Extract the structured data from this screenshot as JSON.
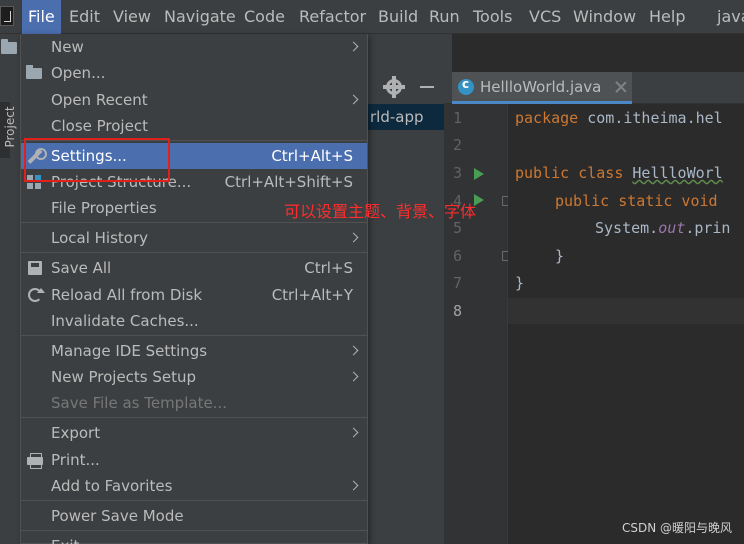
{
  "menubar": {
    "items": [
      {
        "label": "File",
        "active": true
      },
      {
        "label": "Edit"
      },
      {
        "label": "View"
      },
      {
        "label": "Navigate"
      },
      {
        "label": "Code"
      },
      {
        "label": "Refactor"
      },
      {
        "label": "Build"
      },
      {
        "label": "Run"
      },
      {
        "label": "Tools"
      },
      {
        "label": "VCS"
      },
      {
        "label": "Window"
      },
      {
        "label": "Help"
      }
    ],
    "title_fragment": "java"
  },
  "left_strip": {
    "tab_label": "Project"
  },
  "project_panel": {
    "row_label": "rld-app"
  },
  "editor": {
    "tab_label": "HellloWorld.java",
    "line_numbers": [
      "1",
      "2",
      "3",
      "4",
      "5",
      "6",
      "7",
      "8"
    ],
    "code": {
      "l1_kw": "package",
      "l1_rest": " com.itheima.hel",
      "l3_kw": "public class",
      "l3_rest": "HellloWorl",
      "l4_kw": "public static void",
      "l5_a": "System.",
      "l5_b": "out",
      "l5_c": ".prin",
      "l6": "}",
      "l7": "}"
    }
  },
  "file_menu": {
    "new": "New",
    "open": "Open...",
    "open_recent": "Open Recent",
    "close_project": "Close Project",
    "settings": "Settings...",
    "settings_shortcut": "Ctrl+Alt+S",
    "project_structure": "Project Structure...",
    "project_structure_shortcut": "Ctrl+Alt+Shift+S",
    "file_properties": "File Properties",
    "local_history": "Local History",
    "save_all": "Save All",
    "save_all_shortcut": "Ctrl+S",
    "reload": "Reload All from Disk",
    "reload_shortcut": "Ctrl+Alt+Y",
    "invalidate": "Invalidate Caches...",
    "manage_ide": "Manage IDE Settings",
    "new_projects_setup": "New Projects Setup",
    "save_template": "Save File as Template...",
    "export": "Export",
    "print": "Print...",
    "add_favorites": "Add to Favorites",
    "power_save": "Power Save Mode",
    "exit": "Exit"
  },
  "annotation": {
    "text": "可以设置主题、背景、字体"
  },
  "watermark": "CSDN @暖阳与晚风",
  "colors": {
    "accent": "#4b6eaf",
    "annotation_red": "#e0201b",
    "keyword": "#cc7832"
  }
}
